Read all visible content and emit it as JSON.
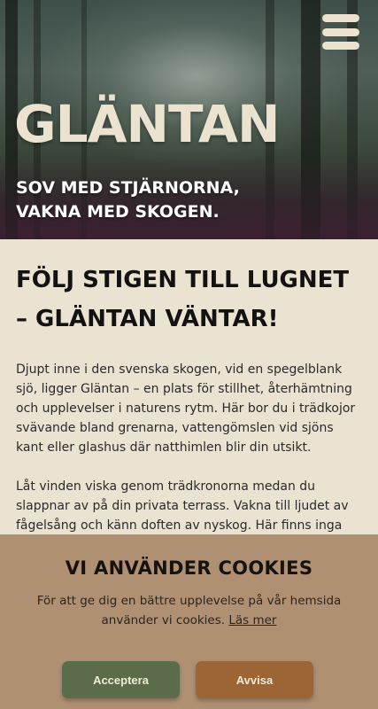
{
  "header": {
    "brand": "GLÄNTAN",
    "tagline_line1": "SOV MED STJÄRNORNA,",
    "tagline_line2": "VAKNA MED SKOGEN.",
    "menu_icon": "hamburger-menu-icon"
  },
  "main": {
    "heading": "FÖLJ STIGEN TILL LUGNET – GLÄNTAN VÄNTAR!",
    "paragraph1": "Djupt inne i den svenska skogen, vid en spegelblank sjö, ligger Gläntan – en plats för stillhet, återhämtning och upplevelser i naturens rytm. Här bor du i trädkojor svävande bland grenarna, vattengömslen vid sjöns kant eller glashus där natthimlen blir din utsikt.",
    "paragraph2": "Låt vinden viska genom trädkronorna medan du slappnar av på din privata terrass. Vakna till ljudet av fågelsång och känn doften av nyskog. Här finns inga distraktioner, ingen stress – bara du, naturen och lugnet."
  },
  "cookie": {
    "title": "VI ANVÄNDER COOKIES",
    "description": "För att ge dig en bättre upplevelse på vår hemsida använder vi cookies.",
    "read_more": "Läs mer",
    "accept_label": "Acceptera",
    "reject_label": "Avvisa"
  },
  "colors": {
    "background": "#ebe3d2",
    "cookie_banner": "#b09072",
    "accept_button": "#5a6c4a",
    "reject_button": "#9b6535"
  }
}
